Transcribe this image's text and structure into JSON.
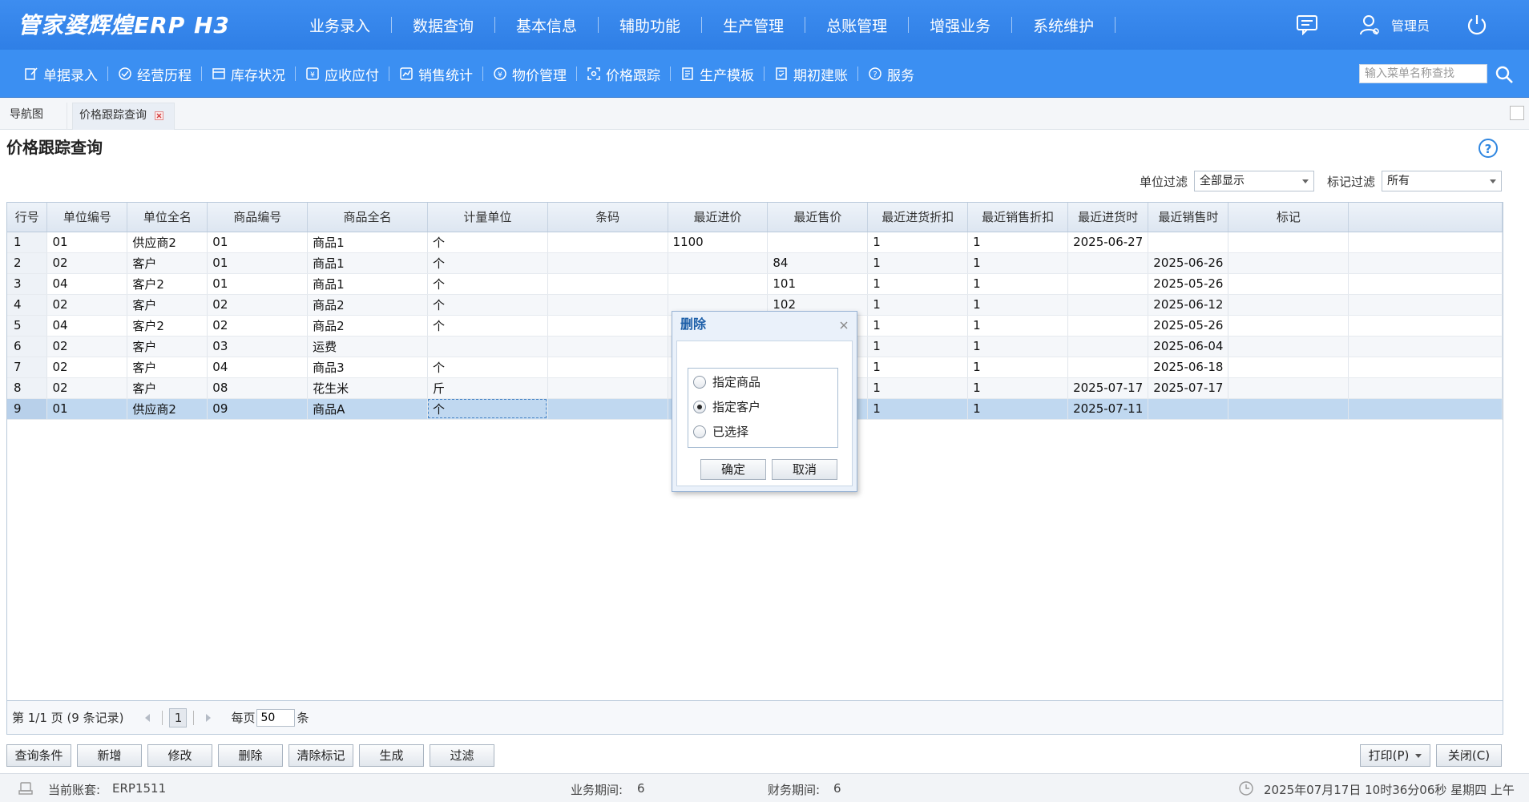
{
  "app": {
    "logo": "管家婆辉煌ERP H3"
  },
  "main_nav": [
    "业务录入",
    "数据查询",
    "基本信息",
    "辅助功能",
    "生产管理",
    "总账管理",
    "增强业务",
    "系统维护"
  ],
  "user": {
    "name": "管理员"
  },
  "toolbar": {
    "items": [
      {
        "label": "单据录入",
        "icon": "doc-edit-icon"
      },
      {
        "label": "经营历程",
        "icon": "check-circle-icon"
      },
      {
        "label": "库存状况",
        "icon": "inventory-icon"
      },
      {
        "label": "应收应付",
        "icon": "receivable-icon"
      },
      {
        "label": "销售统计",
        "icon": "sales-chart-icon"
      },
      {
        "label": "物价管理",
        "icon": "price-tag-icon"
      },
      {
        "label": "价格跟踪",
        "icon": "tracking-icon"
      },
      {
        "label": "生产模板",
        "icon": "template-icon"
      },
      {
        "label": "期初建账",
        "icon": "ledger-icon"
      },
      {
        "label": "服务",
        "icon": "help-circle-icon"
      }
    ],
    "search_placeholder": "输入菜单名称查找"
  },
  "tabs": {
    "nav": "导航图",
    "active": "价格跟踪查询"
  },
  "page": {
    "title": "价格跟踪查询"
  },
  "filters": {
    "unit_label": "单位过滤",
    "unit_value": "全部显示",
    "mark_label": "标记过滤",
    "mark_value": "所有"
  },
  "grid": {
    "columns": [
      "行号",
      "单位编号",
      "单位全名",
      "商品编号",
      "商品全名",
      "计量单位",
      "条码",
      "最近进价",
      "最近售价",
      "最近进货折扣",
      "最近销售折扣",
      "最近进货时",
      "最近销售时",
      "标记",
      ""
    ],
    "rows": [
      [
        "1",
        "01",
        "供应商2",
        "01",
        "商品1",
        "个",
        "",
        "1100",
        "",
        "1",
        "1",
        "2025-06-27",
        "",
        "",
        ""
      ],
      [
        "2",
        "02",
        "客户",
        "01",
        "商品1",
        "个",
        "",
        "",
        "84",
        "1",
        "1",
        "",
        "2025-06-26",
        "",
        ""
      ],
      [
        "3",
        "04",
        "客户2",
        "01",
        "商品1",
        "个",
        "",
        "",
        "101",
        "1",
        "1",
        "",
        "2025-05-26",
        "",
        ""
      ],
      [
        "4",
        "02",
        "客户",
        "02",
        "商品2",
        "个",
        "",
        "",
        "102",
        "1",
        "1",
        "",
        "2025-06-12",
        "",
        ""
      ],
      [
        "5",
        "04",
        "客户2",
        "02",
        "商品2",
        "个",
        "",
        "",
        "",
        "1",
        "1",
        "",
        "2025-05-26",
        "",
        ""
      ],
      [
        "6",
        "02",
        "客户",
        "03",
        "运费",
        "",
        "",
        "",
        "",
        "1",
        "1",
        "",
        "2025-06-04",
        "",
        ""
      ],
      [
        "7",
        "02",
        "客户",
        "04",
        "商品3",
        "个",
        "",
        "",
        "",
        "1",
        "1",
        "",
        "2025-06-18",
        "",
        ""
      ],
      [
        "8",
        "02",
        "客户",
        "08",
        "花生米",
        "斤",
        "",
        "",
        "",
        "1",
        "1",
        "2025-07-17",
        "2025-07-17",
        "",
        ""
      ],
      [
        "9",
        "01",
        "供应商2",
        "09",
        "商品A",
        "个",
        "",
        "",
        "",
        "1",
        "1",
        "2025-07-11",
        "",
        "",
        ""
      ]
    ],
    "selected_row": 9
  },
  "pager": {
    "info": "第 1/1 页 (9 条记录)",
    "current_page": "1",
    "per_page_label": "每页",
    "per_page_value": "50",
    "per_page_suffix": "条"
  },
  "buttons": {
    "left": [
      "查询条件",
      "新增",
      "修改",
      "删除",
      "清除标记",
      "生成",
      "过滤"
    ],
    "print": "打印(P)",
    "close": "关闭(C)"
  },
  "status": {
    "account_label": "当前账套:",
    "account_value": "ERP1511",
    "biz_period_label": "业务期间:",
    "biz_period_value": "6",
    "fin_period_label": "财务期间:",
    "fin_period_value": "6",
    "datetime": "2025年07月17日 10时36分06秒 星期四 上午"
  },
  "dialog": {
    "title": "删除",
    "options": [
      "指定商品",
      "指定客户",
      "已选择"
    ],
    "selected_option": 1,
    "ok": "确定",
    "cancel": "取消"
  },
  "colors": {
    "topbar": "#2f7fe6",
    "toolbar": "#3b8ff2",
    "selected_row": "#c0d8f0",
    "dialog_title": "#1d5fa8"
  }
}
